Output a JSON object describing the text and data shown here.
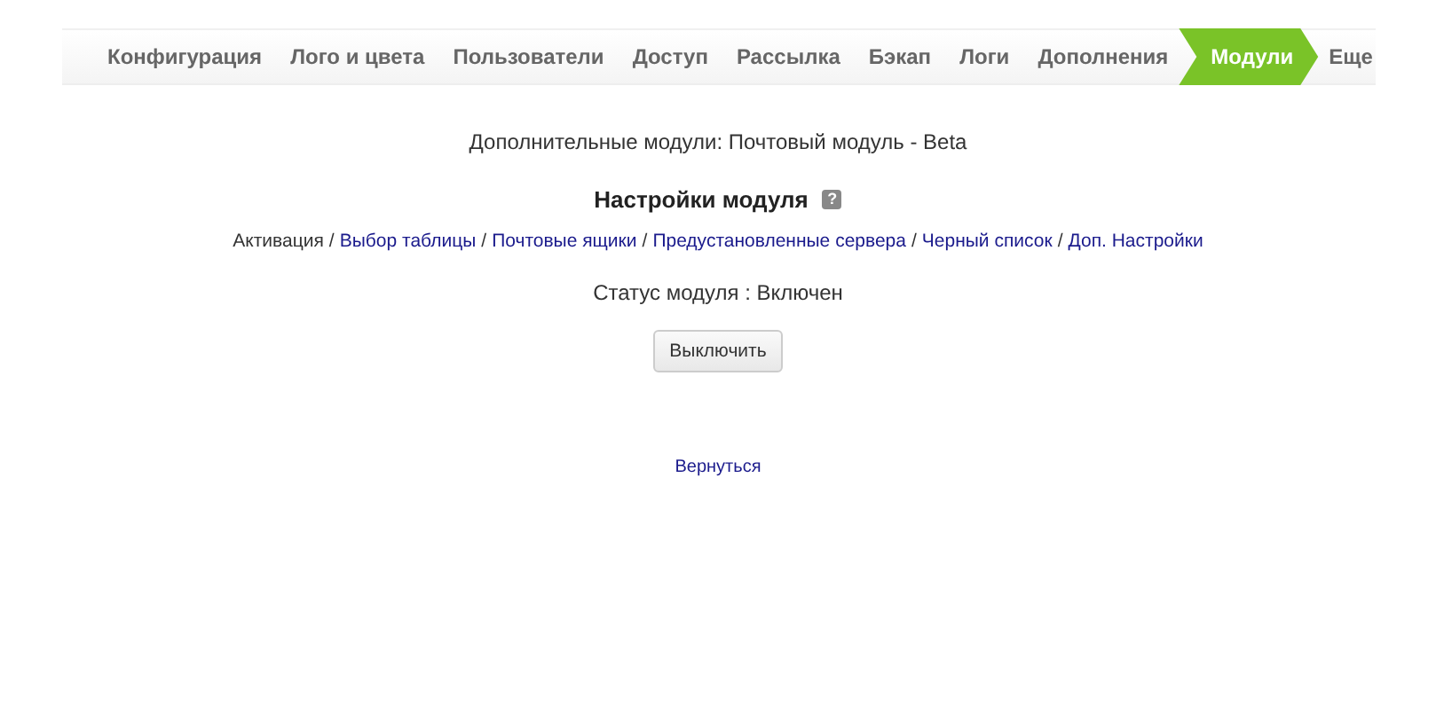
{
  "tabs": [
    {
      "label": "Конфигурация",
      "selected": false
    },
    {
      "label": "Лого и цвета",
      "selected": false
    },
    {
      "label": "Пользователи",
      "selected": false
    },
    {
      "label": "Доступ",
      "selected": false
    },
    {
      "label": "Рассылка",
      "selected": false
    },
    {
      "label": "Бэкап",
      "selected": false
    },
    {
      "label": "Логи",
      "selected": false
    },
    {
      "label": "Дополнения",
      "selected": false
    },
    {
      "label": "Модули",
      "selected": true
    },
    {
      "label": "Еще",
      "selected": false
    }
  ],
  "subtitle": "Дополнительные модули: Почтовый модуль - Beta",
  "heading": "Настройки модуля",
  "help_icon": "?",
  "subnav": {
    "separator": "/",
    "items": [
      {
        "label": "Активация",
        "selected": true
      },
      {
        "label": "Выбор таблицы",
        "selected": false
      },
      {
        "label": "Почтовые ящики",
        "selected": false
      },
      {
        "label": "Предустановленные сервера",
        "selected": false
      },
      {
        "label": "Черный список",
        "selected": false
      },
      {
        "label": "Доп. Настройки",
        "selected": false
      }
    ]
  },
  "status": "Статус модуля : Включен",
  "toggle_button": "Выключить",
  "back_link": "Вернуться"
}
